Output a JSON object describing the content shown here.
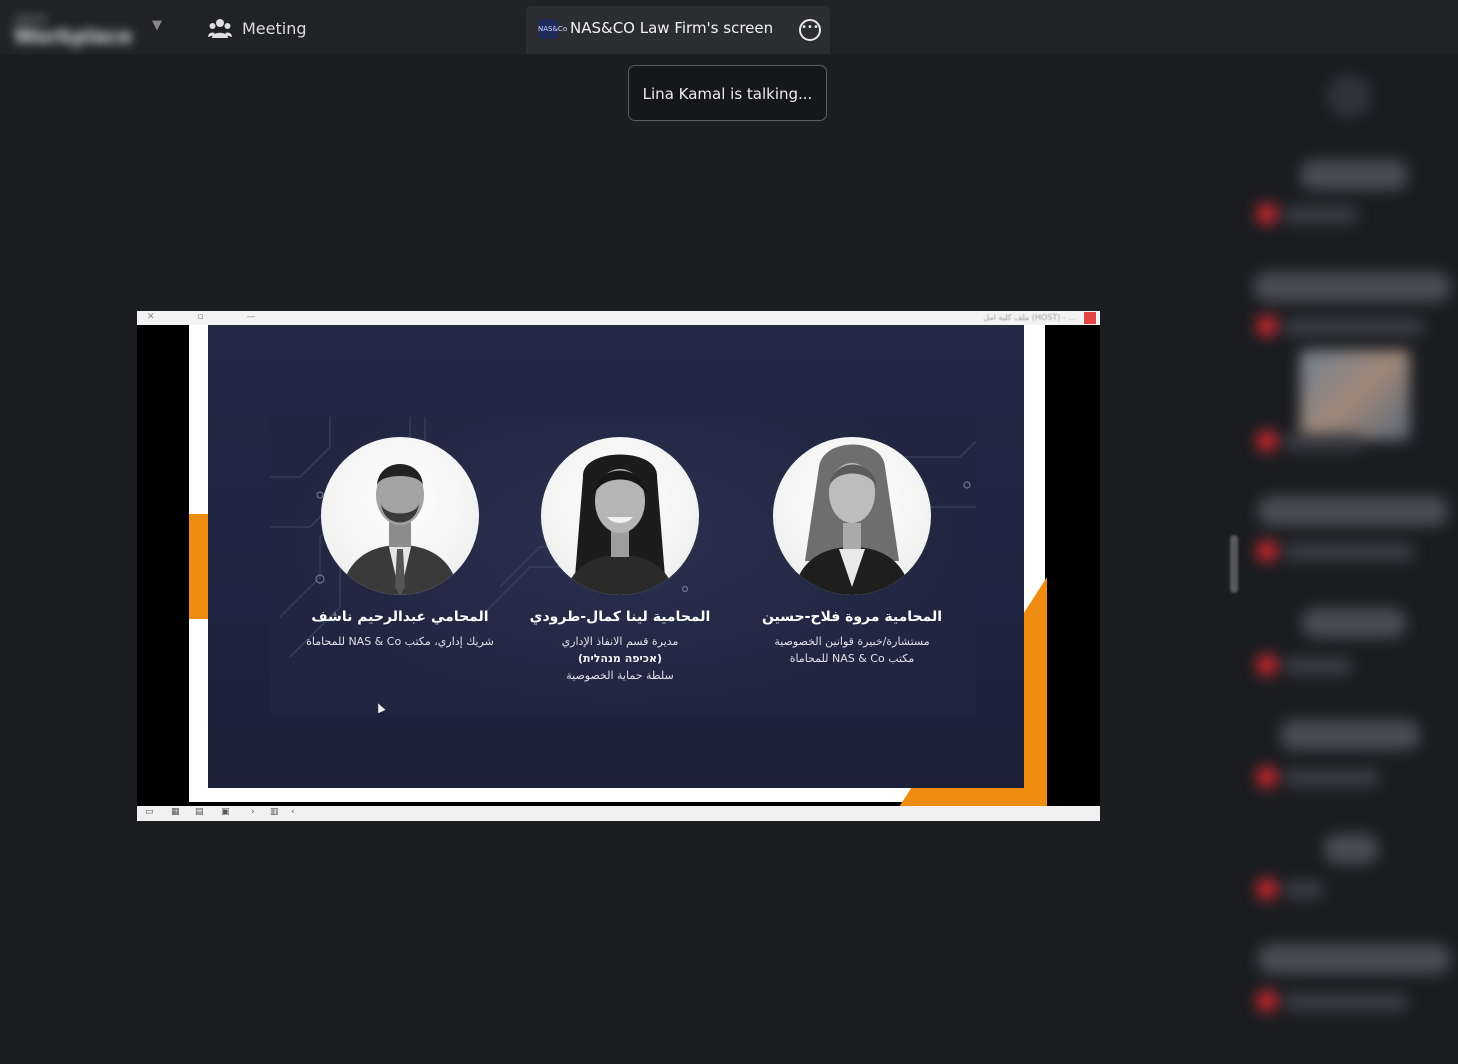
{
  "app": {
    "brand_top": "Jamia",
    "brand_name": "Workplace",
    "meeting_label": "Meeting"
  },
  "share_tab": {
    "logo_text": "NAS&Co",
    "title": "NAS&CO Law Firm's screen"
  },
  "talking_indicator": "Lina Kamal is talking...",
  "ppt": {
    "caption": "ملف كلية امل (HOST) - ...",
    "slide": {
      "people": [
        {
          "name": "المحامي عبدالرحيم ناشف",
          "role_lines": [
            "شريك إداري، مكتب NAS & Co للمحاماة"
          ]
        },
        {
          "name": "المحامية لينا كمال-طرودي",
          "role_lines": [
            "مديرة قسم الانفاذ الإداري",
            "(אכיפה מנהלית)",
            "سلطة حماية الخصوصية"
          ]
        },
        {
          "name": "المحامية مروة فلاح-حسين",
          "role_lines": [
            "مستشارة/خبيرة قوانين الخصوصية",
            "مكتب NAS & Co للمحاماة"
          ]
        }
      ]
    }
  },
  "participants": [
    {
      "name": "",
      "sub": ""
    },
    {
      "name": "",
      "sub": ""
    },
    {
      "name": "",
      "sub": ""
    },
    {
      "name": "",
      "sub": ""
    },
    {
      "name": "",
      "sub": ""
    },
    {
      "name": "",
      "sub": ""
    },
    {
      "name": "",
      "sub": ""
    },
    {
      "name": "",
      "sub": ""
    }
  ],
  "colors": {
    "background": "#1b1d21",
    "slide_bg": "#232944",
    "accent_orange": "#ee8c12",
    "mic_muted": "#c1272d"
  }
}
